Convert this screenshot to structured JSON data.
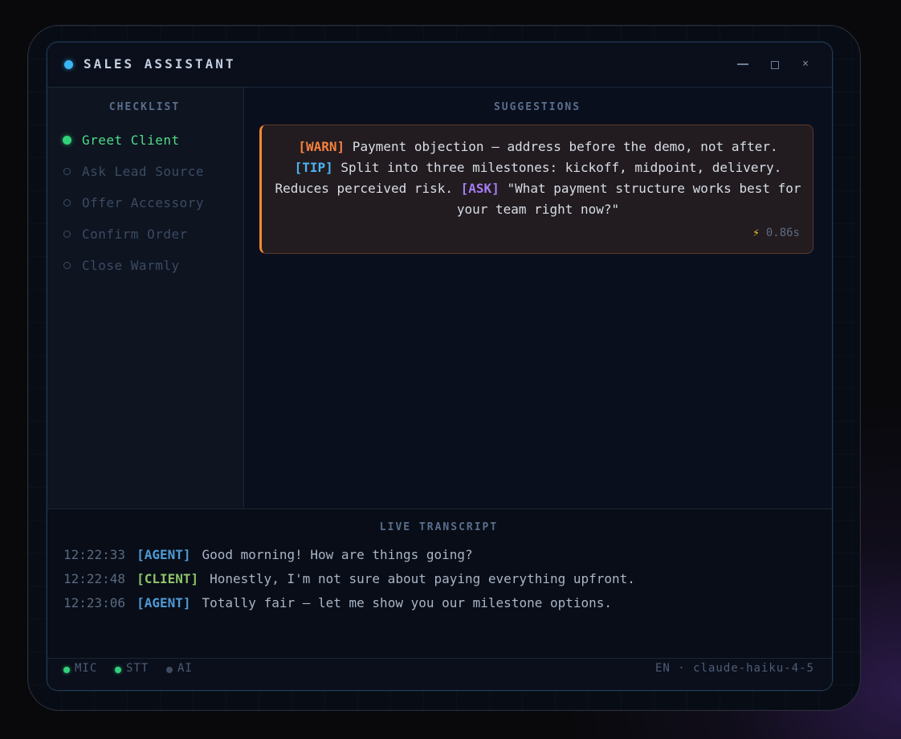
{
  "window": {
    "title": "SALES ASSISTANT",
    "minimize_icon": "minimize-icon",
    "maximize_icon": "maximize-icon",
    "close_label": "×"
  },
  "checklist": {
    "title": "CHECKLIST",
    "items": [
      {
        "label": "Greet Client",
        "done": true
      },
      {
        "label": "Ask Lead Source",
        "done": false
      },
      {
        "label": "Offer Accessory",
        "done": false
      },
      {
        "label": "Confirm Order",
        "done": false
      },
      {
        "label": "Close Warmly",
        "done": false
      }
    ]
  },
  "suggestions": {
    "title": "SUGGESTIONS",
    "card": {
      "warn_tag": "[WARN]",
      "warn_text": " Payment objection — address before the demo, not after.",
      "tip_tag": "[TIP]",
      "tip_text": " Split into three milestones: kickoff, midpoint, delivery. Reduces perceived risk. ",
      "ask_tag": "[ASK]",
      "ask_text": " \"What payment structure works best for your team right now?\"",
      "timing": "0.86s",
      "timing_icon": "⚡"
    }
  },
  "transcript": {
    "title": "LIVE TRANSCRIPT",
    "lines": [
      {
        "time": "12:22:33",
        "speaker": "[AGENT]",
        "role": "agent",
        "text": "Good morning! How are things going?"
      },
      {
        "time": "12:22:48",
        "speaker": "[CLIENT]",
        "role": "client",
        "text": "Honestly, I'm not sure about paying everything upfront."
      },
      {
        "time": "12:23:06",
        "speaker": "[AGENT]",
        "role": "agent",
        "text": "Totally fair — let me show you our milestone options."
      }
    ]
  },
  "status": {
    "mic": "MIC",
    "stt": "STT",
    "ai": "AI",
    "right": "EN · claude-haiku-4-5"
  },
  "colors": {
    "accent": "#3bb6f5",
    "success": "#33d17a",
    "warn": "#f5813d",
    "tip": "#4cb3f2",
    "ask": "#a67cf0"
  }
}
